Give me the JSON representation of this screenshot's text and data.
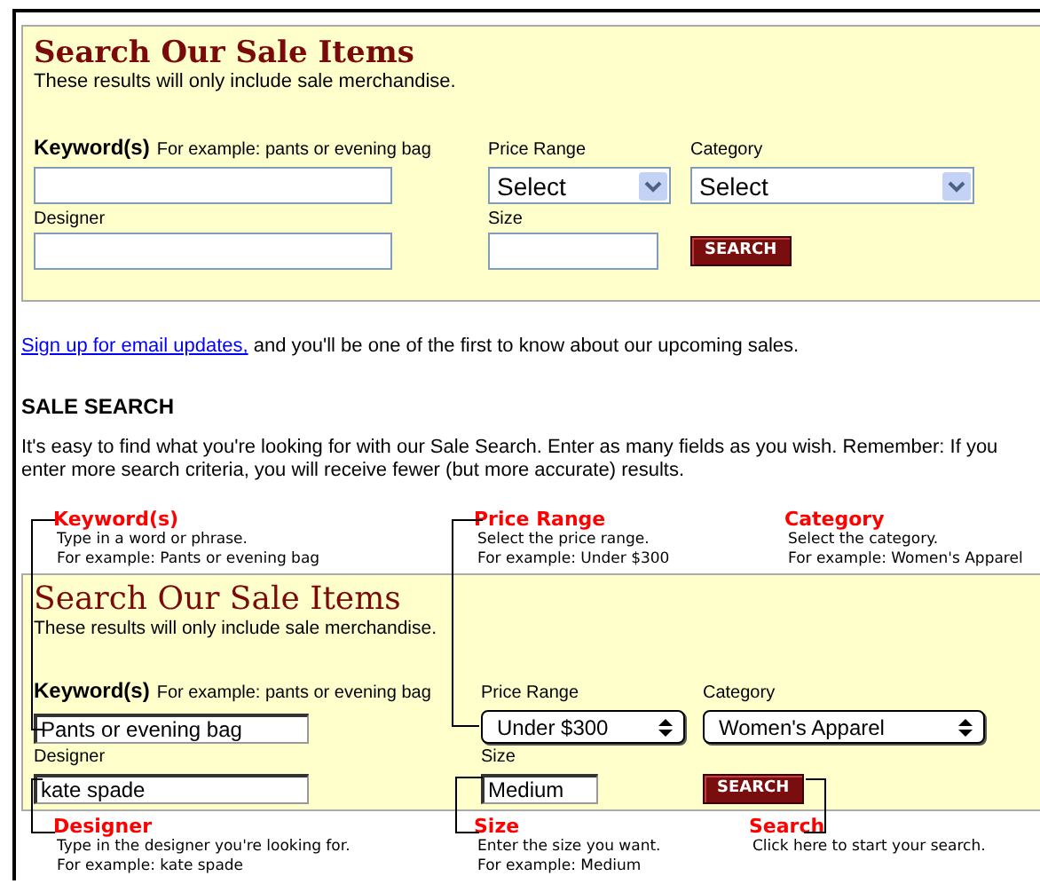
{
  "search_panel": {
    "kind": "live",
    "title": "Search Our Sale Items",
    "subtitle": "These results will only include sale merchandise.",
    "keyword_label": "Keyword(s)",
    "keyword_hint": "For example: pants or evening bag",
    "price_label": "Price Range",
    "price_value": "Select",
    "category_label": "Category",
    "category_value": "Select",
    "designer_label": "Designer",
    "size_label": "Size",
    "search_button": "SEARCH"
  },
  "signup": {
    "link": "Sign up for email updates,",
    "text": " and you'll be one of the first to know about our upcoming sales."
  },
  "section_heading": "SALE SEARCH",
  "intro": "It's easy to find what you're looking for with our Sale Search. Enter as many fields as you wish. Remember: If you enter more search criteria, you will receive fewer (but more accurate) results.",
  "callouts_top": [
    {
      "title": "Keyword(s)",
      "line1": "Type in a word or phrase.",
      "line2": "For example: Pants or evening bag"
    },
    {
      "title": "Price Range",
      "line1": "Select the price range.",
      "line2": "For example: Under $300"
    },
    {
      "title": "Category",
      "line1": "Select the category.",
      "line2": "For example: Women's Apparel"
    }
  ],
  "example_panel": {
    "kind": "example",
    "title": "Search Our Sale Items",
    "subtitle": "These results will only include sale merchandise.",
    "keyword_label": "Keyword(s)",
    "keyword_hint": "For example: pants or evening bag",
    "keyword_value": "Pants or evening bag",
    "price_label": "Price Range",
    "price_value": "Under $300",
    "category_label": "Category",
    "category_value": "Women's Apparel",
    "designer_label": "Designer",
    "designer_value": "kate spade",
    "size_label": "Size",
    "size_value": "Medium",
    "search_button": "SEARCH"
  },
  "callouts_bottom": [
    {
      "title": "Designer",
      "line1": "Type in the designer you're looking for.",
      "line2": "For example: kate spade"
    },
    {
      "title": "Size",
      "line1": "Enter the size you want.",
      "line2": "For example: Medium"
    },
    {
      "title": "Search",
      "line1": "Click here to start your search."
    }
  ]
}
